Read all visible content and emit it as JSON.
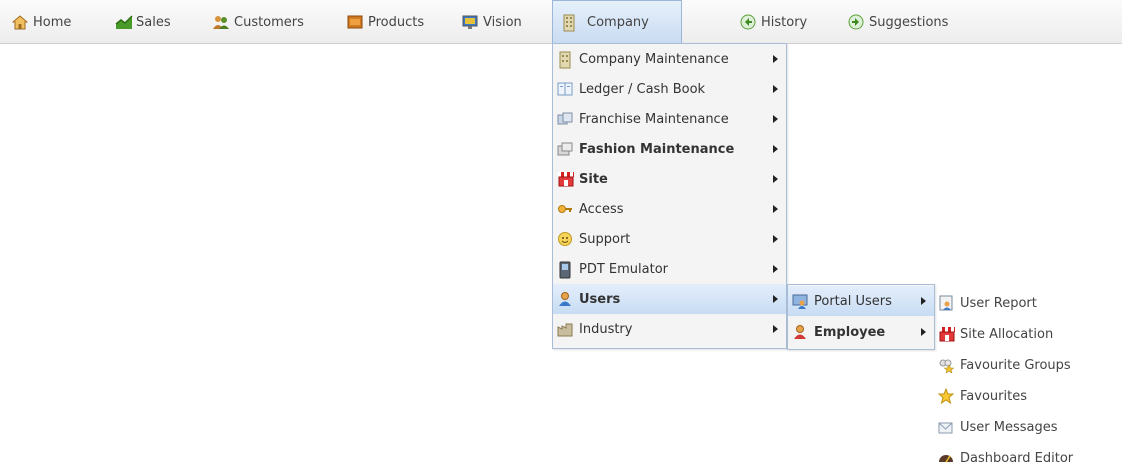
{
  "nav": {
    "home": "Home",
    "sales": "Sales",
    "customers": "Customers",
    "products": "Products",
    "vision": "Vision",
    "company": "Company",
    "history": "History",
    "suggestions": "Suggestions"
  },
  "company_menu": {
    "items": [
      {
        "label": "Company Maintenance",
        "icon": "building-icon"
      },
      {
        "label": "Ledger / Cash Book",
        "icon": "ledger-book-icon"
      },
      {
        "label": "Franchise Maintenance",
        "icon": "franchise-icon"
      },
      {
        "label": "Fashion Maintenance",
        "icon": "fashion-icon"
      },
      {
        "label": "Site",
        "icon": "store-icon"
      },
      {
        "label": "Access",
        "icon": "key-icon"
      },
      {
        "label": "Support",
        "icon": "support-face-icon"
      },
      {
        "label": "PDT Emulator",
        "icon": "handheld-device-icon"
      },
      {
        "label": "Users",
        "icon": "user-icon"
      },
      {
        "label": "Industry",
        "icon": "factory-icon"
      }
    ]
  },
  "users_menu": {
    "items": [
      {
        "label": "Portal Users",
        "icon": "portal-users-icon"
      },
      {
        "label": "Employee",
        "icon": "employee-icon"
      }
    ]
  },
  "portal_menu": {
    "items": [
      {
        "label": "User Report",
        "icon": "report-icon"
      },
      {
        "label": "Site Allocation",
        "icon": "store-icon"
      },
      {
        "label": "Favourite Groups",
        "icon": "favourite-groups-icon"
      },
      {
        "label": "Favourites",
        "icon": "star-icon"
      },
      {
        "label": "User Messages",
        "icon": "envelope-icon"
      },
      {
        "label": "Dashboard Editor",
        "icon": "dashboard-icon"
      }
    ]
  }
}
